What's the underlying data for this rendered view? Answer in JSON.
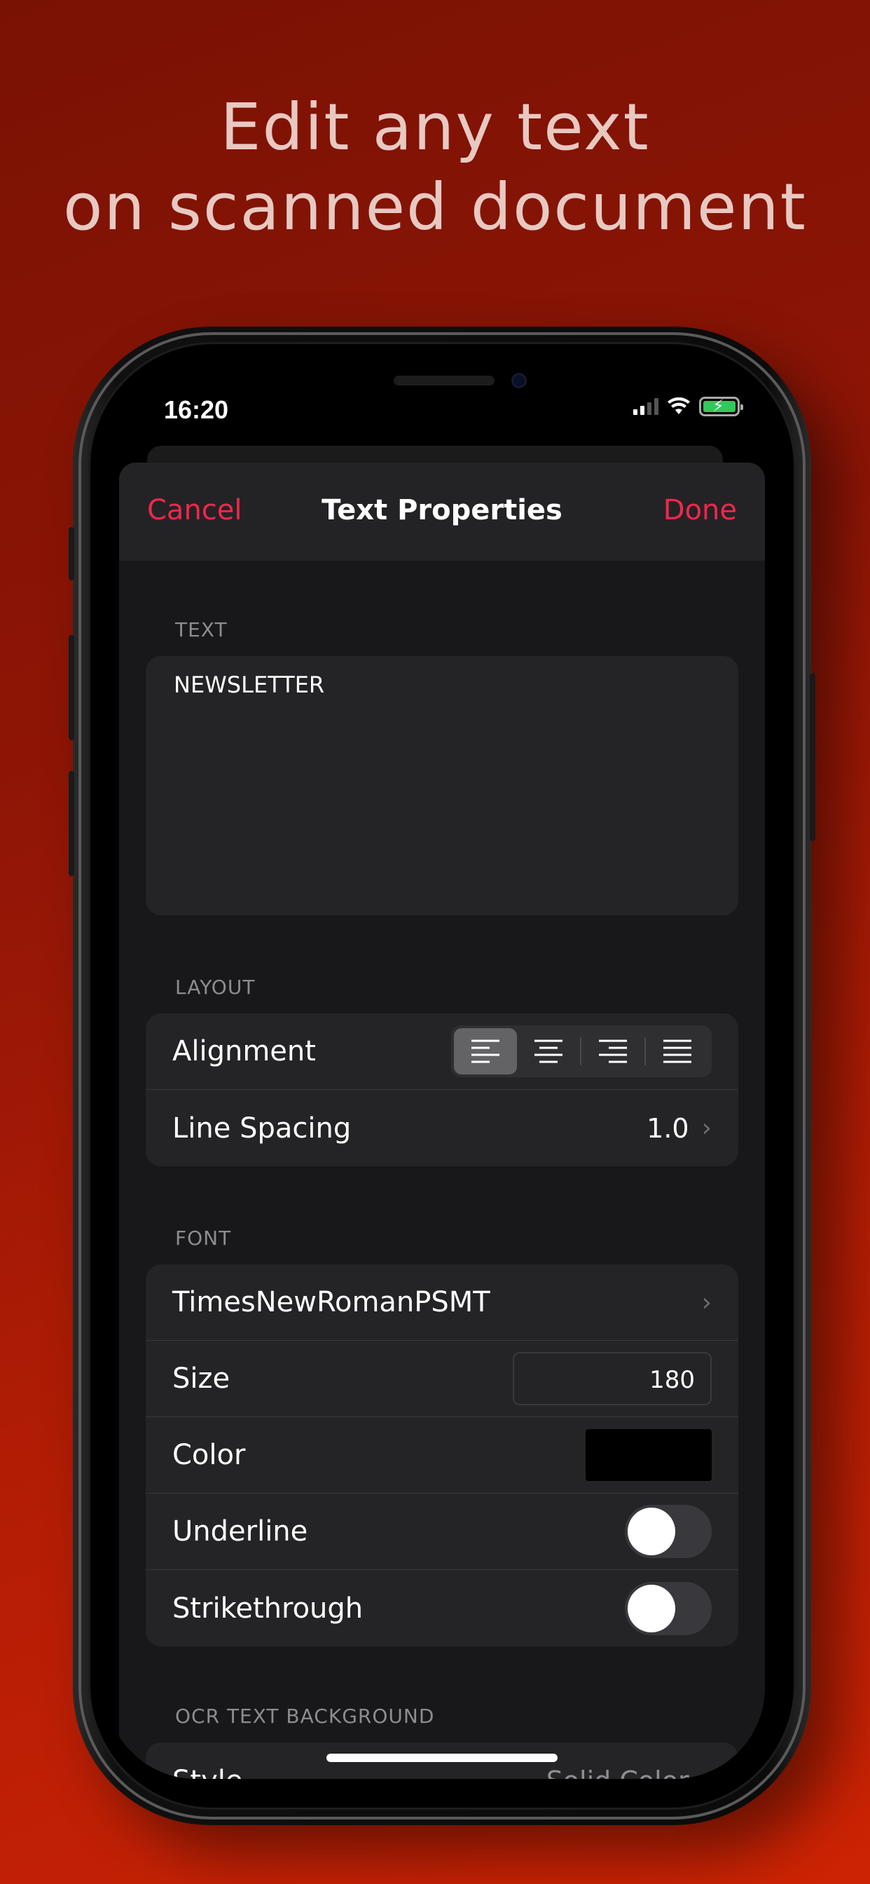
{
  "headline": {
    "line1": "Edit any text",
    "line2": "on scanned document"
  },
  "status_bar": {
    "time": "16:20",
    "icons": [
      "signal-icon",
      "wifi-icon",
      "battery-charging-icon"
    ]
  },
  "navbar": {
    "cancel_label": "Cancel",
    "title": "Text Properties",
    "done_label": "Done"
  },
  "sections": {
    "text": {
      "header": "TEXT",
      "value": "NEWSLETTER"
    },
    "layout": {
      "header": "LAYOUT",
      "alignment_label": "Alignment",
      "alignment_options": [
        "align-left-icon",
        "align-center-icon",
        "align-right-icon",
        "align-justify-icon"
      ],
      "alignment_selected": "align-left-icon",
      "line_spacing_label": "Line Spacing",
      "line_spacing_value": "1.0"
    },
    "font": {
      "header": "FONT",
      "font_name": "TimesNewRomanPSMT",
      "size_label": "Size",
      "size_value": "180",
      "color_label": "Color",
      "color_value": "#000000",
      "underline_label": "Underline",
      "underline_on": false,
      "strikethrough_label": "Strikethrough",
      "strikethrough_on": false
    },
    "ocr_background": {
      "header": "OCR TEXT BACKGROUND",
      "style_label": "Style",
      "style_value": "Solid Color"
    }
  },
  "colors": {
    "accent": "#f2274c",
    "background_top": "#7a1204",
    "background_bottom": "#cc2304"
  }
}
